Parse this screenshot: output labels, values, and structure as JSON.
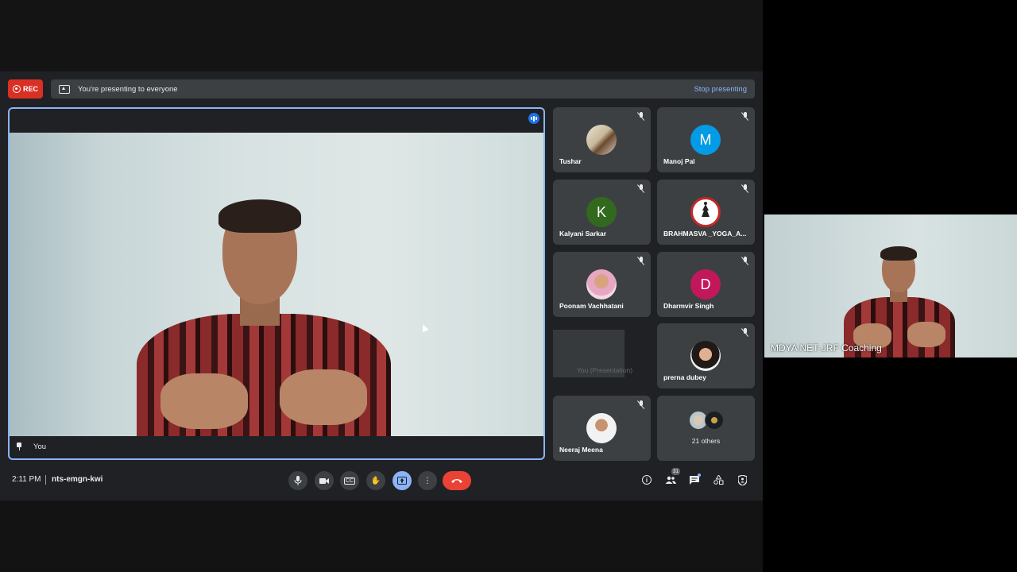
{
  "top_bar": {
    "rec_label": "REC",
    "presenting_text": "You're presenting to everyone",
    "stop_presenting_label": "Stop presenting"
  },
  "main_video": {
    "name_label": "You",
    "speaking": true
  },
  "participants": [
    {
      "name": "Tushar",
      "avatar_type": "photo",
      "muted": true
    },
    {
      "name": "Manoj Pal",
      "avatar_type": "letter",
      "letter": "M",
      "color": "#039be5",
      "muted": true
    },
    {
      "name": "Kalyani Sarkar",
      "avatar_type": "letter",
      "letter": "K",
      "color": "#33691e",
      "muted": true
    },
    {
      "name": "BRAHMASVA _YOGA_A...",
      "avatar_type": "logo",
      "muted": true
    },
    {
      "name": "Poonam Vachhatani",
      "avatar_type": "photo",
      "muted": true
    },
    {
      "name": "Dharmvir Singh",
      "avatar_type": "letter",
      "letter": "D",
      "color": "#c2185b",
      "muted": true
    },
    {
      "name": "You (Presentation)",
      "avatar_type": "presentation",
      "muted": false
    },
    {
      "name": "prerna dubey",
      "avatar_type": "photo",
      "muted": true
    },
    {
      "name": "Neeraj Meena",
      "avatar_type": "photo",
      "muted": true
    },
    {
      "name": "21 others",
      "avatar_type": "group",
      "muted": false
    }
  ],
  "bottom_bar": {
    "time": "2:11 PM",
    "meeting_code": "nts-emgn-kwi",
    "controls": [
      "mic-icon",
      "camera-icon",
      "captions-icon",
      "raise-hand-icon",
      "present-icon",
      "more-icon",
      "end-call-icon"
    ],
    "captions_label": "CC",
    "participant_count": "31"
  },
  "pip": {
    "label": "MDYA NET-JRF Coaching"
  }
}
